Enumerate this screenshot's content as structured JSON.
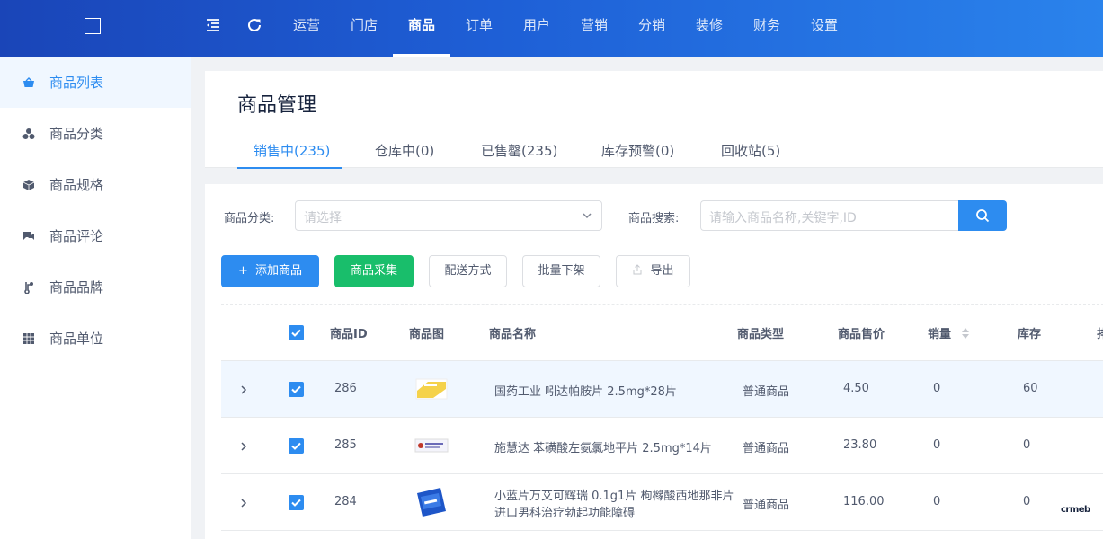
{
  "topbar": {
    "nav": [
      {
        "label": "运营",
        "active": false
      },
      {
        "label": "门店",
        "active": false
      },
      {
        "label": "商品",
        "active": true
      },
      {
        "label": "订单",
        "active": false
      },
      {
        "label": "用户",
        "active": false
      },
      {
        "label": "营销",
        "active": false
      },
      {
        "label": "分销",
        "active": false
      },
      {
        "label": "装修",
        "active": false
      },
      {
        "label": "财务",
        "active": false
      },
      {
        "label": "设置",
        "active": false
      }
    ]
  },
  "sidebar": {
    "items": [
      {
        "label": "商品列表",
        "icon": "basket-icon",
        "active": true
      },
      {
        "label": "商品分类",
        "icon": "cluster-icon",
        "active": false
      },
      {
        "label": "商品规格",
        "icon": "cube-icon",
        "active": false
      },
      {
        "label": "商品评论",
        "icon": "comment-icon",
        "active": false
      },
      {
        "label": "商品品牌",
        "icon": "brand-icon",
        "active": false
      },
      {
        "label": "商品单位",
        "icon": "grid-icon",
        "active": false
      }
    ]
  },
  "header": {
    "title": "商品管理",
    "tabs": [
      {
        "label": "销售中(235)",
        "active": true
      },
      {
        "label": "仓库中(0)",
        "active": false
      },
      {
        "label": "已售罄(235)",
        "active": false
      },
      {
        "label": "库存预警(0)",
        "active": false
      },
      {
        "label": "回收站(5)",
        "active": false
      }
    ]
  },
  "filters": {
    "category_label": "商品分类:",
    "category_placeholder": "请选择",
    "search_label": "商品搜索:",
    "search_placeholder": "请输入商品名称,关键字,ID"
  },
  "actions": {
    "add": "添加商品",
    "collect": "商品采集",
    "delivery": "配送方式",
    "batch_off": "批量下架",
    "export": "导出"
  },
  "table": {
    "columns": {
      "id": "商品ID",
      "image": "商品图",
      "name": "商品名称",
      "type": "商品类型",
      "price": "商品售价",
      "sales": "销量",
      "stock": "库存",
      "more": "排"
    },
    "rows": [
      {
        "id": "286",
        "name_lines": [
          "国药工业 吲达帕胺片 2.5mg*28片"
        ],
        "type": "普通商品",
        "price": "4.50",
        "sales": "0",
        "stock": "60",
        "checked": true
      },
      {
        "id": "285",
        "name_lines": [
          "施慧达 苯磺酸左氨氯地平片 2.5mg*14片"
        ],
        "type": "普通商品",
        "price": "23.80",
        "sales": "0",
        "stock": "0",
        "checked": true
      },
      {
        "id": "284",
        "name_lines": [
          "小蓝片万艾可辉瑞 0.1g1片 枸橼酸西地那非片",
          "进口男科治疗勃起功能障碍"
        ],
        "type": "普通商品",
        "price": "116.00",
        "sales": "0",
        "stock": "0",
        "checked": true
      }
    ]
  },
  "watermark": "crmeb",
  "colors": {
    "primary": "#2d8cf0",
    "success": "#19be6b",
    "topbar_start": "#1a45b8",
    "topbar_end": "#2a83ec"
  }
}
